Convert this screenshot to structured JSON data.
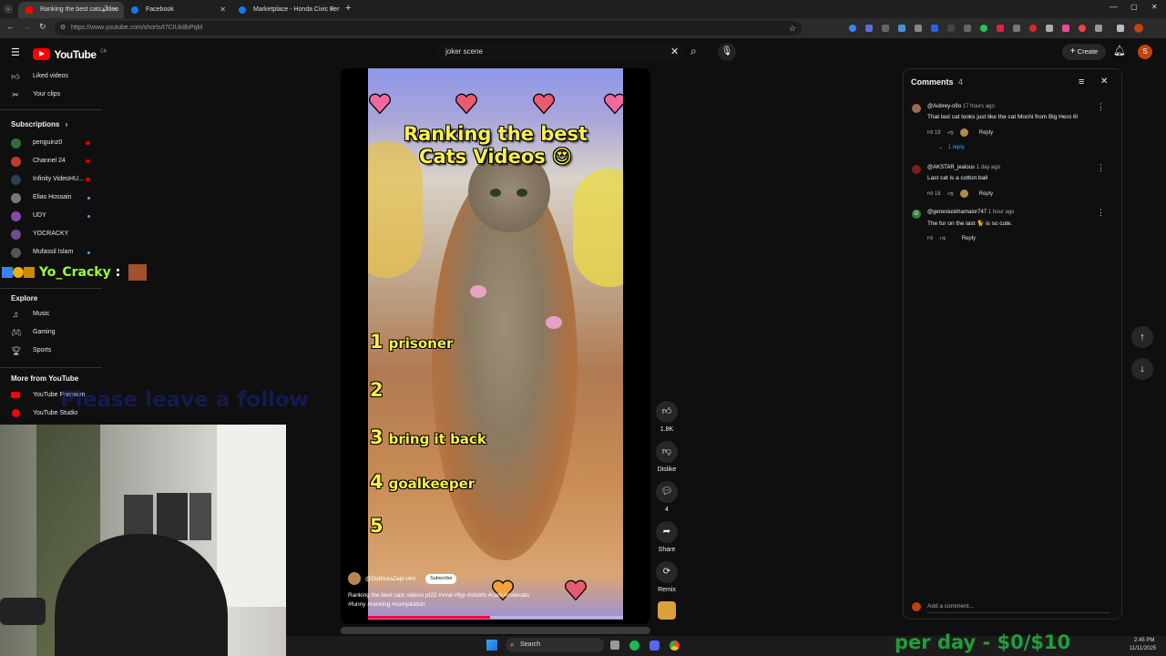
{
  "browser": {
    "tabs": [
      {
        "title": "Ranking the best cats video",
        "favicon_color": "#ff0000",
        "active": true
      },
      {
        "title": "Facebook",
        "favicon_color": "#1877f2",
        "active": false
      },
      {
        "title": "Marketplace - Honda Civic Fer",
        "favicon_color": "#1877f2",
        "active": false
      }
    ],
    "new_tab": "+",
    "url": "https://www.youtube.com/shorts/t7CIUk8bPqM"
  },
  "youtube": {
    "logo": "YouTube",
    "logo_sup": "CA",
    "search_value": "joker scene",
    "create_label": "Create",
    "avatar_letter": "S"
  },
  "sidebar": {
    "top_items": [
      {
        "label": "Liked videos",
        "icon": "thumbs-up-icon"
      },
      {
        "label": "Your clips",
        "icon": "scissors-icon"
      }
    ],
    "subscriptions_title": "Subscriptions",
    "subscriptions": [
      {
        "label": "penguinz0",
        "color": "#3a6b3a",
        "live": true
      },
      {
        "label": "Channel 24",
        "color": "#c0392b",
        "live": true
      },
      {
        "label": "Infinity VideoHU...",
        "color": "#2c3e50",
        "live": true
      },
      {
        "label": "Elias Hossain",
        "color": "#777777",
        "live": false
      },
      {
        "label": "UDY",
        "color": "#8e44ad",
        "live": false
      },
      {
        "label": "YOCRACKY",
        "color": "#6d4c91",
        "live": false
      },
      {
        "label": "Mufassil Islam",
        "color": "#555555",
        "live": false
      }
    ],
    "explore_title": "Explore",
    "explore": [
      {
        "label": "Music",
        "icon": "music-icon"
      },
      {
        "label": "Gaming",
        "icon": "gaming-icon"
      },
      {
        "label": "Sports",
        "icon": "trophy-icon"
      }
    ],
    "more_title": "More from YouTube",
    "more": [
      {
        "label": "YouTube Premium",
        "color": "#ff0000"
      },
      {
        "label": "YouTube Studio",
        "color": "#ff0000"
      }
    ]
  },
  "video": {
    "title_line1": "Ranking the best",
    "title_line2": "Cats Videos 😍",
    "ranks": [
      {
        "num": "1",
        "text": "prisoner"
      },
      {
        "num": "2",
        "text": ""
      },
      {
        "num": "3",
        "text": "bring it back"
      },
      {
        "num": "4",
        "text": "goalkeeper"
      },
      {
        "num": "5",
        "text": ""
      }
    ],
    "channel": "@DidiItulaZapi-i4m",
    "subscribe_label": "Subscribe",
    "description": "Ranking the best cats videos pt22 #viral #fyp #shorts #cats #cutecats",
    "description2": "#funny #ranking #compilation"
  },
  "actions": {
    "like_count": "1.8K",
    "dislike_label": "Dislike",
    "comment_count": "4",
    "share_label": "Share",
    "remix_label": "Remix"
  },
  "comments": {
    "title": "Comments",
    "count": "4",
    "items": [
      {
        "handle": "@Aubrey-o9o",
        "time": "17 hours ago",
        "text": "That last cat looks just like the cat Mochi from Big Hero 6!",
        "likes": "19",
        "reply_label": "Reply",
        "replies": "1 reply",
        "avatar_color": "#9a6a55"
      },
      {
        "handle": "@AKSTAR_jealous",
        "time": "1 day ago",
        "text": "Last cat is a cotton ball",
        "likes": "18",
        "reply_label": "Reply",
        "replies": "",
        "avatar_color": "#7b1e1e"
      },
      {
        "handle": "@genesiuskharnaior747",
        "time": "1 hour ago",
        "text": "The fur on the last 🐈 is so cute.",
        "likes": "",
        "reply_label": "Reply",
        "replies": "",
        "avatar_color": "#2e7d32",
        "avatar_letter": "G"
      }
    ],
    "add_placeholder": "Add a comment..."
  },
  "overlay": {
    "username": "Yo_Cracky",
    "follow_text": "Please leave a follow",
    "per_day": "per day - $0/$10"
  },
  "taskbar": {
    "search_label": "Search",
    "time": "2:45 PM",
    "date": "11/11/2025"
  }
}
